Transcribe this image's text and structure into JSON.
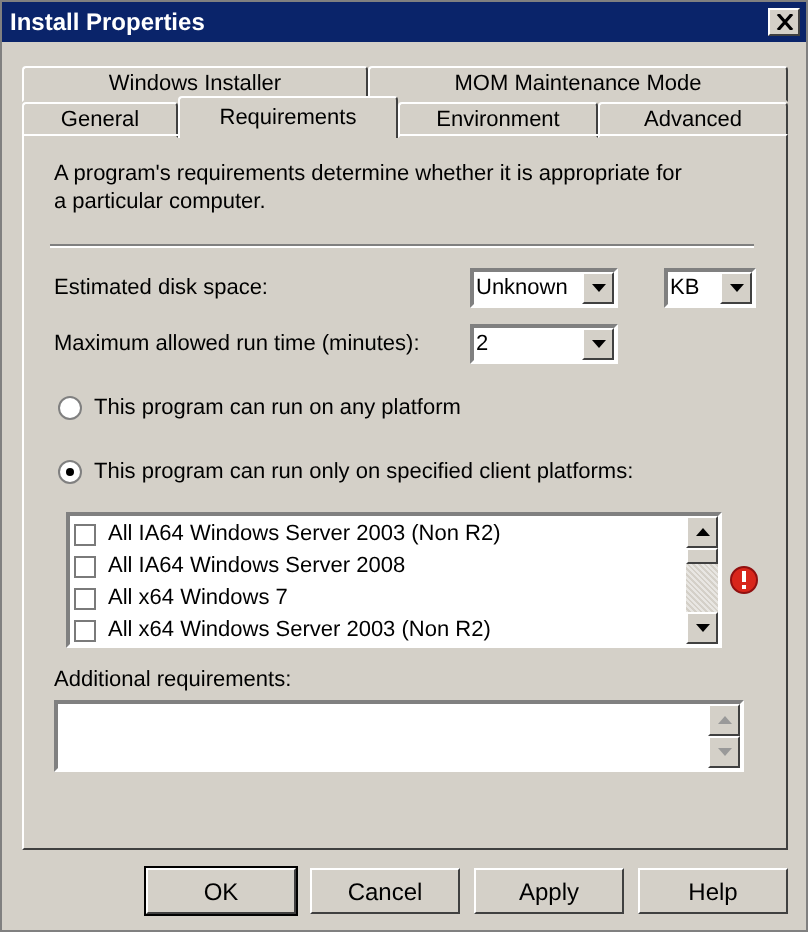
{
  "window": {
    "title": "Install Properties"
  },
  "tab_rows": [
    {
      "tabs": [
        {
          "label": "Windows Installer",
          "selected": false
        },
        {
          "label": "MOM Maintenance Mode",
          "selected": false
        }
      ]
    },
    {
      "tabs": [
        {
          "label": "General",
          "selected": false
        },
        {
          "label": "Requirements",
          "selected": true
        },
        {
          "label": "Environment",
          "selected": false
        },
        {
          "label": "Advanced",
          "selected": false
        }
      ]
    }
  ],
  "description": "A program's requirements determine whether it is appropriate for a particular computer.",
  "disk_space": {
    "label": "Estimated disk space:",
    "value": "Unknown",
    "unit": "KB"
  },
  "run_time": {
    "label": "Maximum allowed run time (minutes):",
    "value": "2"
  },
  "platform_options": [
    {
      "label": "This program can run on any platform",
      "selected": false
    },
    {
      "label": "This program can run only on specified client platforms:",
      "selected": true
    }
  ],
  "platforms": [
    {
      "label": "All IA64 Windows Server 2003 (Non R2)",
      "checked": false
    },
    {
      "label": "All IA64 Windows Server 2008",
      "checked": false
    },
    {
      "label": "All x64 Windows 7",
      "checked": false
    },
    {
      "label": "All x64 Windows Server 2003 (Non R2)",
      "checked": false
    }
  ],
  "additional": {
    "label": "Additional requirements:"
  },
  "buttons": [
    {
      "label": "OK",
      "default": true
    },
    {
      "label": "Cancel",
      "default": false
    },
    {
      "label": "Apply",
      "default": false
    },
    {
      "label": "Help",
      "default": false
    }
  ]
}
